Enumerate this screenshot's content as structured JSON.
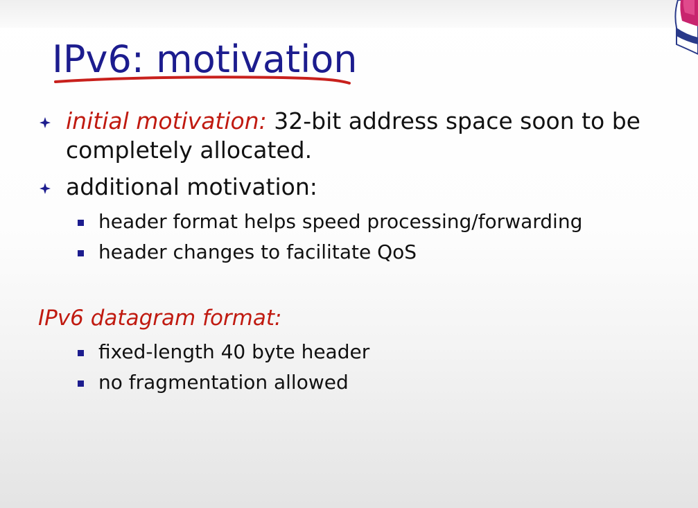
{
  "slide": {
    "title": "IPv6: motivation",
    "bullets": [
      {
        "emphasis": "initial motivation:",
        "text_line1": " 32-bit address space soon to be",
        "text_line2": "completely allocated."
      },
      {
        "text": "additional motivation:",
        "sub_bullets": [
          "header format helps speed processing/forwarding",
          "header changes to facilitate QoS"
        ]
      }
    ],
    "section_heading": "IPv6 datagram format:",
    "section_bullets": [
      "fixed-length 40 byte header",
      "no fragmentation allowed"
    ]
  },
  "colors": {
    "title": "#1c1c8e",
    "emphasis": "#c01a10",
    "body_text": "#111111",
    "bullet_marker": "#1c1c8e",
    "underline": "#c8201c"
  }
}
